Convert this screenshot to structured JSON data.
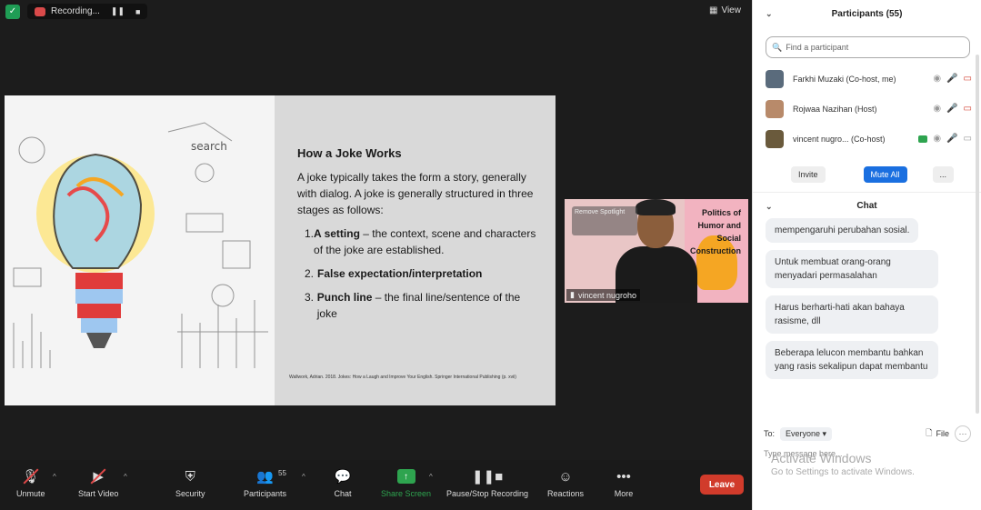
{
  "topbar": {
    "recording_label": "Recording...",
    "view_label": "View"
  },
  "slide": {
    "title": "How a Joke Works",
    "intro": "A joke typically takes the form a story, generally with dialog. A joke is generally  structured in three stages as follows:",
    "items": [
      {
        "num": "1.",
        "bold": "A setting",
        "rest": " – the context, scene and characters of the joke are established."
      },
      {
        "num": "2.",
        "bold": "False expectation/interpretation",
        "rest": ""
      },
      {
        "num": "3.",
        "bold": "Punch line",
        "rest": " – the final line/sentence of the joke"
      }
    ],
    "reference": "Wallwork, Adrian. 2018. Jokes: How a Laugh and Improve Your English. Springer International Publishing (p. xvii)"
  },
  "speaker": {
    "slide_title": "Politics of Humor and Social Construction",
    "name": "vincent nugroho",
    "overlay": "Remove Spotlight"
  },
  "toolbar": {
    "unmute": "Unmute",
    "start_video": "Start Video",
    "security": "Security",
    "participants": "Participants",
    "participants_count": "55",
    "chat": "Chat",
    "share_screen": "Share Screen",
    "pause_stop_recording": "Pause/Stop Recording",
    "reactions": "Reactions",
    "more": "More",
    "leave": "Leave"
  },
  "participants_panel": {
    "title": "Participants (55)",
    "search_placeholder": "Find a participant",
    "list": [
      {
        "name": "Farkhi Muzaki (Co-host, me)"
      },
      {
        "name": "Rojwaa Nazihan (Host)"
      },
      {
        "name": "vincent nugro... (Co-host)"
      }
    ],
    "invite": "Invite",
    "mute_all": "Mute All",
    "more": "..."
  },
  "chat_panel": {
    "title": "Chat",
    "messages": [
      "mempengaruhi perubahan sosial.",
      "Untuk membuat orang-orang menyadari permasalahan",
      "Harus berharti-hati akan bahaya rasisme, dll",
      "Beberapa lelucon membantu bahkan yang rasis sekalipun dapat membantu"
    ],
    "to_label": "To:",
    "to_value": "Everyone",
    "file_label": "File",
    "type_placeholder": "Type message here...",
    "activate_title": "Activate Windows",
    "activate_sub": "Go to Settings to activate Windows."
  }
}
